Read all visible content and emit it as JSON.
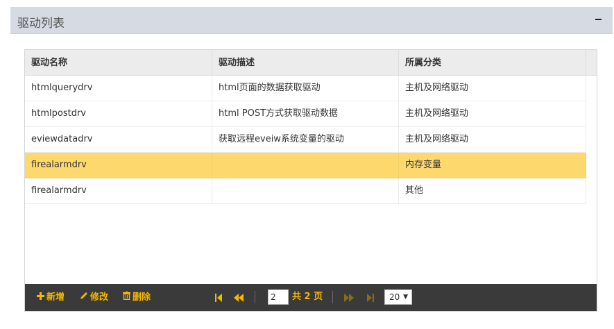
{
  "panel": {
    "title": "驱动列表"
  },
  "table": {
    "columns": [
      "驱动名称",
      "驱动描述",
      "所属分类"
    ],
    "rows": [
      {
        "name": "htmlquerydrv",
        "desc": "html页面的数据获取驱动",
        "category": "主机及网络驱动",
        "selected": false
      },
      {
        "name": "htmlpostdrv",
        "desc": "html POST方式获取驱动数据",
        "category": "主机及网络驱动",
        "selected": false
      },
      {
        "name": "eviewdatadrv",
        "desc": "获取远程eveiw系统变量的驱动",
        "category": "主机及网络驱动",
        "selected": false
      },
      {
        "name": "firealarmdrv",
        "desc": "",
        "category": "内存变量",
        "selected": true
      },
      {
        "name": "firealarmdrv",
        "desc": "",
        "category": "其他",
        "selected": false
      }
    ]
  },
  "toolbar": {
    "add_label": "新增",
    "edit_label": "修改",
    "delete_label": "删除",
    "current_page": "2",
    "total_pages_label": "共 2 页",
    "page_size": "20"
  },
  "icons": {
    "add": "plus-icon",
    "edit": "pencil-icon",
    "delete": "trash-icon",
    "first": "first-page-icon",
    "prev": "prev-page-icon",
    "next": "next-page-icon",
    "last": "last-page-icon",
    "collapse": "minus-icon"
  },
  "colors": {
    "header_bg": "#d6dae3",
    "selected_row": "#fdd96d",
    "toolbar_bg": "#3a3a3a",
    "accent": "#f5b800"
  }
}
